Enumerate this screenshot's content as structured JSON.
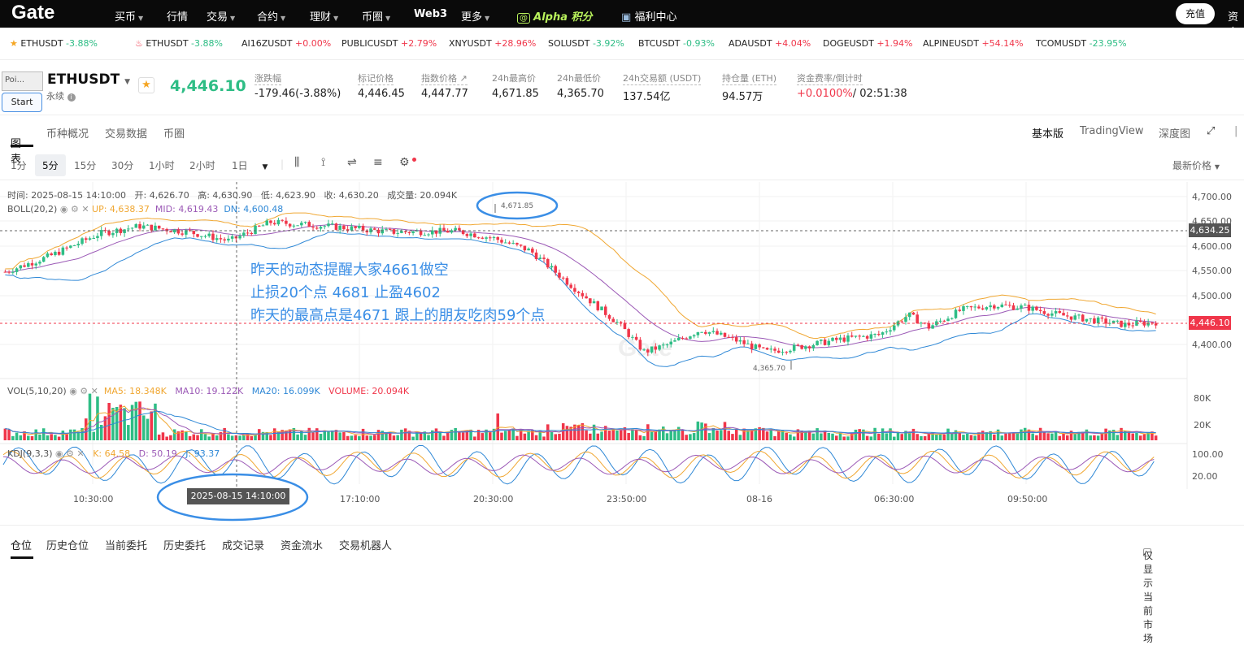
{
  "nav": {
    "logo": "Gate",
    "items": [
      "买币",
      "行情",
      "交易",
      "合约",
      "理财",
      "币圈",
      "Web3",
      "更多"
    ],
    "alpha": "Alpha 积分",
    "welfare": "福利中心",
    "deposit": "充值",
    "asset": "资产"
  },
  "ticker": [
    {
      "sym": "ETHUSDT",
      "chg": "-3.88%",
      "dir": "dn"
    },
    {
      "sym": "ETHUSDT",
      "chg": "-3.88%",
      "dir": "dn"
    },
    {
      "sym": "AI16ZUSDT",
      "chg": "+0.00%",
      "dir": "up"
    },
    {
      "sym": "PUBLICUSDT",
      "chg": "+2.79%",
      "dir": "up"
    },
    {
      "sym": "XNYUSDT",
      "chg": "+28.96%",
      "dir": "up"
    },
    {
      "sym": "SOLUSDT",
      "chg": "-3.92%",
      "dir": "dn"
    },
    {
      "sym": "BTCUSDT",
      "chg": "-0.93%",
      "dir": "dn"
    },
    {
      "sym": "ADAUSDT",
      "chg": "+4.04%",
      "dir": "up"
    },
    {
      "sym": "DOGEUSDT",
      "chg": "+1.94%",
      "dir": "up"
    },
    {
      "sym": "ALPINEUSDT",
      "chg": "+54.14%",
      "dir": "up"
    },
    {
      "sym": "TCOMUSDT",
      "chg": "-23.95%",
      "dir": "dn"
    }
  ],
  "header": {
    "poi": "Poi...",
    "start": "Start",
    "symbol": "ETHUSDT",
    "sub": "永续",
    "price": "4,446.10",
    "stats": [
      {
        "label": "涨跌幅",
        "value": "-179.46(-3.88%)"
      },
      {
        "label": "标记价格",
        "value": "4,446.45"
      },
      {
        "label": "指数价格 ↗",
        "value": "4,447.77"
      },
      {
        "label": "24h最高价",
        "value": "4,671.85"
      },
      {
        "label": "24h最低价",
        "value": "4,365.70"
      },
      {
        "label": "24h交易额 (USDT)",
        "value": "137.54亿"
      },
      {
        "label": "持仓量 (ETH)",
        "value": "94.57万"
      },
      {
        "label": "资金费率/倒计时",
        "value": "+0.0100%",
        "value2": "/ 02:51:38"
      }
    ]
  },
  "tabs": {
    "left": [
      "图表",
      "币种概况",
      "交易数据",
      "币圈"
    ],
    "right": [
      "基本版",
      "TradingView",
      "深度图"
    ]
  },
  "toolbar": {
    "intervals": [
      "1分",
      "5分",
      "15分",
      "30分",
      "1小时",
      "2小时",
      "1日"
    ],
    "price_type": "最新价格"
  },
  "chart": {
    "ohlc": "时间: 2025-08-15 14:10:00   开: 4,626.70   高: 4,630.90   低: 4,623.90   收: 4,630.20   成交量: 20.094K",
    "boll": {
      "name": "BOLL(20,2)",
      "up": "UP: 4,638.37",
      "mid": "MID: 4,619.43",
      "dn": "DN: 4,600.48"
    },
    "vol": {
      "name": "VOL(5,10,20)",
      "ma5": "MA5: 18.348K",
      "ma10": "MA10: 19.122K",
      "ma20": "MA20: 16.099K",
      "volume": "VOLUME: 20.094K"
    },
    "kdj": {
      "name": "KDJ(9,3,3)",
      "k": "K: 64.58",
      "d": "D: 50.19",
      "j": "J: 93.37"
    },
    "y_ticks": [
      "4,700.00",
      "4,650.00",
      "4,600.00",
      "4,550.00",
      "4,500.00",
      "4,450.00",
      "4,400.00"
    ],
    "vol_ticks": [
      "80K",
      "20K"
    ],
    "kdj_ticks": [
      "100.00",
      "20.00"
    ],
    "crosshair_price": "4,634.25",
    "last_price": "4,446.10",
    "high_label": "4,671.85",
    "low_label": "4,365.70",
    "x_ticks": [
      "10:30:00",
      "17:10:00",
      "20:30:00",
      "23:50:00",
      "08-16",
      "06:30:00",
      "09:50:00"
    ],
    "crosshair_time": "2025-08-15 14:10:00",
    "annotation": [
      "昨天的动态提醒大家4661做空",
      "止损20个点 4681  止盈4602",
      "昨天的最高点是4671  跟上的朋友吃肉59个点"
    ],
    "watermark": "Gate"
  },
  "bottom": {
    "tabs": [
      "仓位",
      "历史仓位",
      "当前委托",
      "历史委托",
      "成交记录",
      "资金流水",
      "交易机器人"
    ],
    "only_current": "仅显示当前市场"
  },
  "colors": {
    "up": "#f0364a",
    "down": "#2ebd85",
    "boll_up": "#f0a732",
    "boll_mid": "#9b59b6",
    "boll_dn": "#2f88d6"
  }
}
